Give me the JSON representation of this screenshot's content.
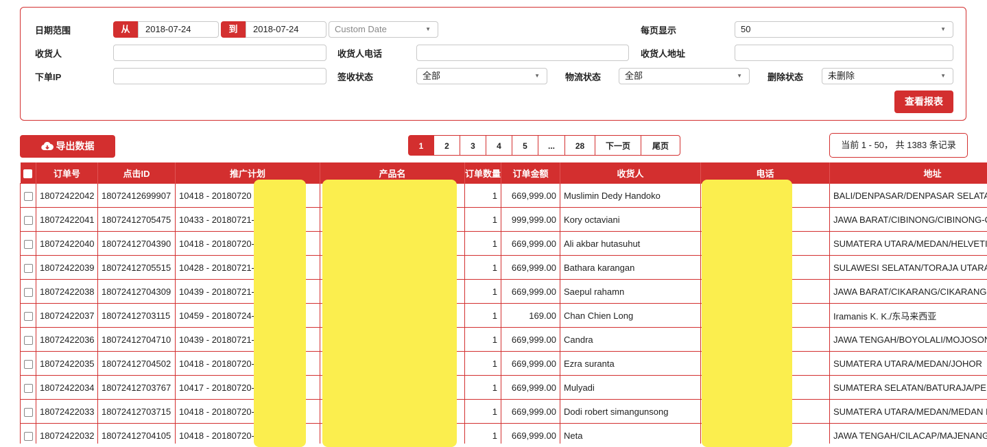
{
  "filters": {
    "date_range_label": "日期范围",
    "from_tag": "从",
    "from_date": "2018-07-24",
    "to_tag": "到",
    "to_date": "2018-07-24",
    "date_preset": "Custom Date",
    "per_page_label": "每页显示",
    "per_page_value": "50",
    "receiver_label": "收货人",
    "receiver_phone_label": "收货人电话",
    "receiver_address_label": "收货人地址",
    "order_ip_label": "下单IP",
    "sign_status_label": "签收状态",
    "sign_status_value": "全部",
    "logistics_status_label": "物流状态",
    "logistics_status_value": "全部",
    "delete_status_label": "删除状态",
    "delete_status_value": "未删除",
    "view_report_button": "查看报表"
  },
  "toolbar": {
    "export_button": "导出数据",
    "pages": [
      "1",
      "2",
      "3",
      "4",
      "5",
      "...",
      "28",
      "下一页",
      "尾页"
    ],
    "current_page": "1",
    "record_info": "当前 1 - 50， 共 1383 条记录"
  },
  "table": {
    "columns": [
      "订单号",
      "点击ID",
      "推广计划",
      "产品名",
      "订单数量",
      "订单金额",
      "收货人",
      "电话",
      "地址"
    ],
    "rows": [
      {
        "order_no": "18072422042",
        "click_id": "18072412699907",
        "plan": "10418 - 20180720",
        "qty": "1",
        "amount": "669,999.00",
        "receiver": "Muslimin Dedy Handoko",
        "address": "BALI/DENPASAR/DENPASAR SELATAN"
      },
      {
        "order_no": "18072422041",
        "click_id": "18072412705475",
        "plan": "10433 - 20180721-",
        "qty": "1",
        "amount": "999,999.00",
        "receiver": "Kory octaviani",
        "address": "JAWA BARAT/CIBINONG/CIBINONG-C"
      },
      {
        "order_no": "18072422040",
        "click_id": "18072412704390",
        "plan": "10418 - 20180720-",
        "qty": "1",
        "amount": "669,999.00",
        "receiver": "Ali akbar hutasuhut",
        "address": "SUMATERA UTARA/MEDAN/HELVETIA"
      },
      {
        "order_no": "18072422039",
        "click_id": "18072412705515",
        "plan": "10428 - 20180721-",
        "qty": "1",
        "amount": "669,999.00",
        "receiver": "Bathara karangan",
        "address": "SULAWESI SELATAN/TORAJA UTARA"
      },
      {
        "order_no": "18072422038",
        "click_id": "18072412704309",
        "plan": "10439 - 20180721-",
        "qty": "1",
        "amount": "669,999.00",
        "receiver": "Saepul rahamn",
        "address": "JAWA BARAT/CIKARANG/CIKARANG"
      },
      {
        "order_no": "18072422037",
        "click_id": "18072412703115",
        "plan": "10459 - 20180724-",
        "qty": "1",
        "amount": "169.00",
        "receiver": "Chan Chien Long",
        "address": "Iramanis K. K./东马来西亚"
      },
      {
        "order_no": "18072422036",
        "click_id": "18072412704710",
        "plan": "10439 - 20180721-",
        "qty": "1",
        "amount": "669,999.00",
        "receiver": "Candra",
        "address": "JAWA TENGAH/BOYOLALI/MOJOSONGO"
      },
      {
        "order_no": "18072422035",
        "click_id": "18072412704502",
        "plan": "10418 - 20180720-",
        "qty": "1",
        "amount": "669,999.00",
        "receiver": "Ezra suranta",
        "address": "SUMATERA UTARA/MEDAN/JOHOR"
      },
      {
        "order_no": "18072422034",
        "click_id": "18072412703767",
        "plan": "10417 - 20180720-",
        "qty": "1",
        "amount": "669,999.00",
        "receiver": "Mulyadi",
        "address": "SUMATERA SELATAN/BATURAJA/PENG"
      },
      {
        "order_no": "18072422033",
        "click_id": "18072412703715",
        "plan": "10418 - 20180720-",
        "qty": "1",
        "amount": "669,999.00",
        "receiver": "Dodi robert simangunsong",
        "address": "SUMATERA UTARA/MEDAN/MEDAN I"
      },
      {
        "order_no": "18072422032",
        "click_id": "18072412704105",
        "plan": "10418 - 20180720-",
        "qty": "1",
        "amount": "669,999.00",
        "receiver": "Neta",
        "address": "JAWA TENGAH/CILACAP/MAJENANG"
      }
    ]
  },
  "colors": {
    "accent": "#d32f2f",
    "redaction": "#fbee4e"
  },
  "icons": {
    "export": "cloud-download-icon",
    "caret": "caret-down-icon"
  }
}
